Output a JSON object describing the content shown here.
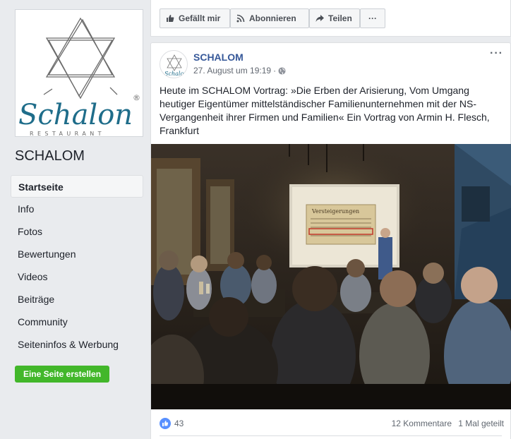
{
  "page": {
    "logo_text": "Schalon",
    "logo_subtext": "RESTAURANT",
    "name": "SCHALOM"
  },
  "nav": {
    "items": [
      "Startseite",
      "Info",
      "Fotos",
      "Bewertungen",
      "Videos",
      "Beiträge",
      "Community",
      "Seiteninfos & Werbung"
    ],
    "create_page_label": "Eine Seite erstellen"
  },
  "action_bar": {
    "like_label": "Gefällt mir",
    "subscribe_label": "Abonnieren",
    "share_label": "Teilen",
    "more_label": "···"
  },
  "post": {
    "author": "SCHALOM",
    "timestamp": "27. August um 19:19",
    "separator": "·",
    "more_label": "···",
    "text": "Heute im SCHALOM Vortrag: »Die Erben der Arisierung, Vom Umgang heutiger Eigentümer mittelständischer Familienunternehmen mit der NS-Vergangenheit ihrer Firmen und Familien« Ein Vortrag von Armin H. Flesch, Frankfurt",
    "slide_heading": "Versteigerungen",
    "reactions_count": "43",
    "comments_label": "12 Kommentare",
    "shares_label": "1 Mal geteilt"
  },
  "colors": {
    "link_blue": "#365899",
    "accent_green": "#42b72a",
    "like_blue": "#5890ff",
    "background": "#e9ebee"
  }
}
